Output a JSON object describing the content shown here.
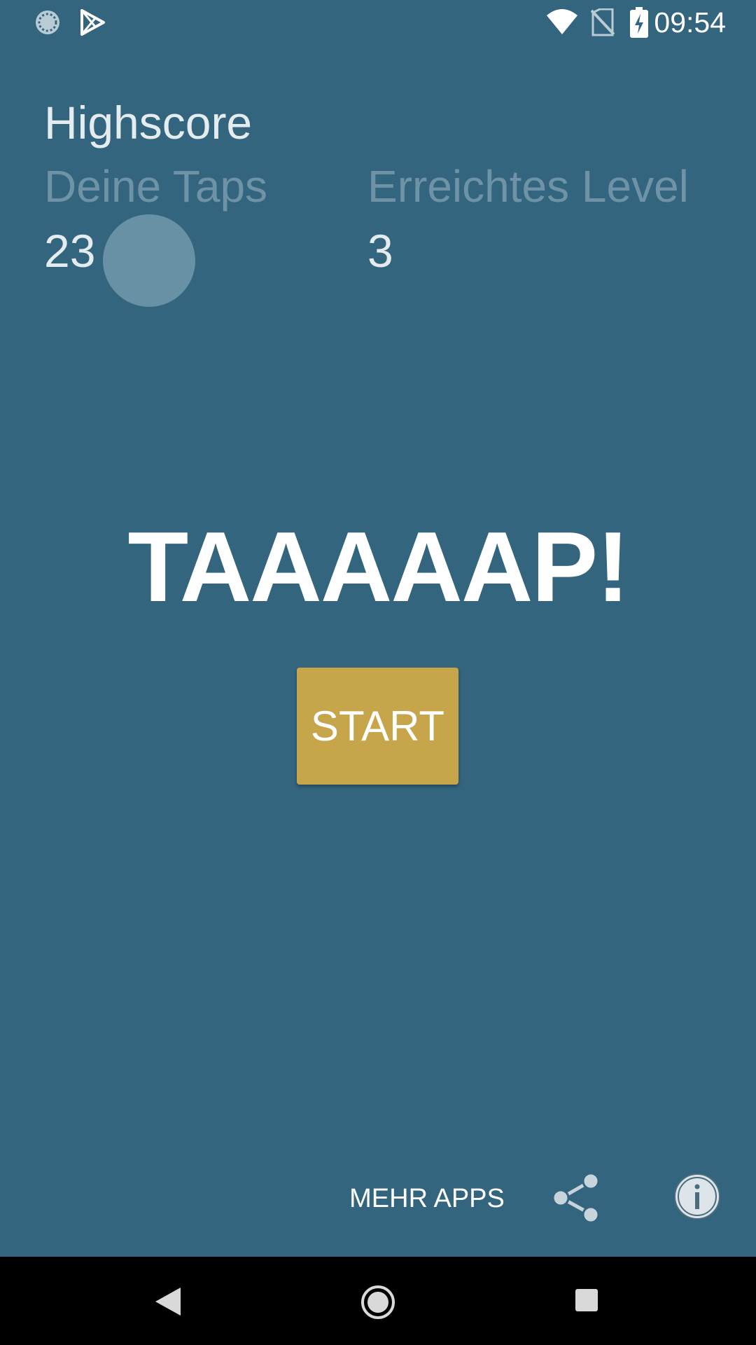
{
  "status_bar": {
    "time": "09:54",
    "left_icons": [
      "sync-icon",
      "play-store-icon"
    ],
    "right_icons": [
      "wifi-icon",
      "no-sim-icon",
      "battery-charging-icon"
    ]
  },
  "highscore": {
    "title": "Highscore",
    "taps_label": "Deine Taps",
    "taps_value": "23",
    "level_label": "Erreichtes Level",
    "level_value": "3"
  },
  "main": {
    "title": "TAAAAAP!",
    "start_label": "START"
  },
  "bottom_actions": {
    "more_apps_label": "MEHR APPS",
    "share_icon": "share-icon",
    "info_icon": "info-icon"
  },
  "nav_bar": {
    "buttons": [
      "back-icon",
      "home-icon",
      "recents-icon"
    ]
  },
  "colors": {
    "background": "#33657e",
    "label_muted": "#6e93a6",
    "text_light": "#e4ecf0",
    "accent_button": "#c6a54b",
    "nav_bar": "#000000"
  }
}
